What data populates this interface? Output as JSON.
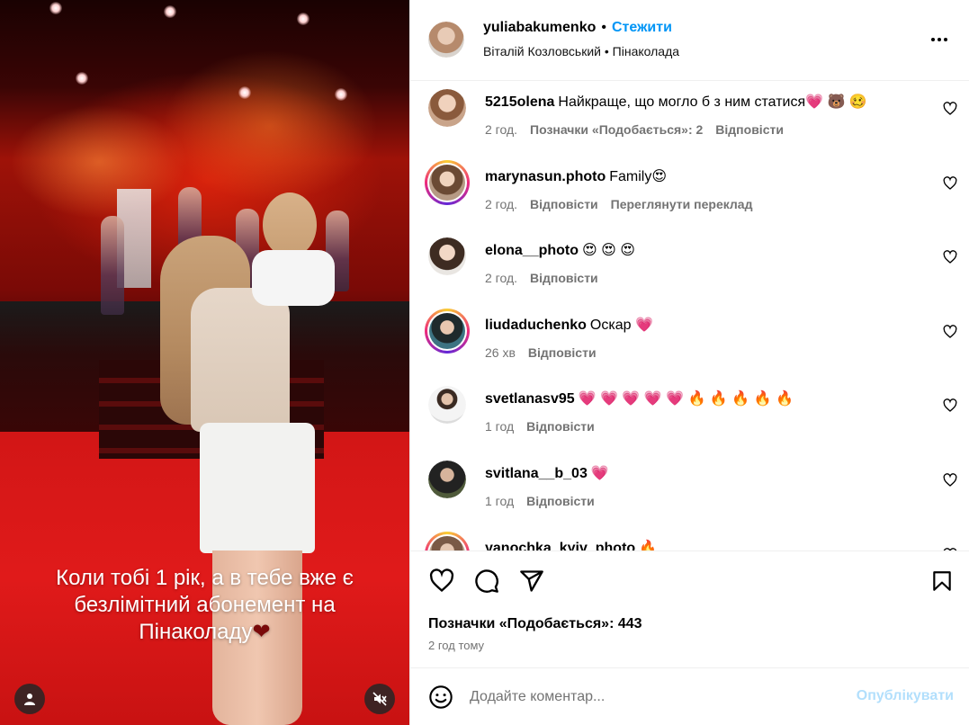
{
  "media": {
    "caption_lines": [
      "Коли тобі 1 рік, а в тебе вже є",
      "безлімітний абонемент на",
      "Пінаколаду"
    ],
    "caption_emoji": "❤",
    "caption_emoji_color": "#7a0a0a"
  },
  "header": {
    "username": "yuliabakumenko",
    "dot": "•",
    "follow_label": "Стежити",
    "subtitle_a": "Віталій Козловський",
    "subtitle_dot": "•",
    "subtitle_b": "Пінаколада"
  },
  "comments": [
    {
      "user": "5215olena",
      "text": "Найкраще, що могло б з ним статися💗 🐻 🥴",
      "time": "2 год.",
      "likes": "Позначки «Подобається»: 2",
      "reply": "Відповісти",
      "extra": "",
      "ring": false,
      "avatar_color": "#c9a48a"
    },
    {
      "user": "marynasun.photo",
      "text": "Family😍",
      "time": "2 год.",
      "likes": "",
      "reply": "Відповісти",
      "extra": "Переглянути переклад",
      "ring": true,
      "avatar_color": "#a7856b"
    },
    {
      "user": "elona__photo",
      "text": "😍 😍 😍",
      "time": "2 год.",
      "likes": "",
      "reply": "Відповісти",
      "extra": "",
      "ring": false,
      "avatar_color": "#6f5a4a"
    },
    {
      "user": "liudaduchenko",
      "text": "Оскар 💗",
      "time": "26 хв",
      "likes": "",
      "reply": "Відповісти",
      "extra": "",
      "ring": true,
      "avatar_color": "#2f5a66"
    },
    {
      "user": "svetlanasv95",
      "text": "💗 💗 💗 💗 💗 🔥 🔥 🔥 🔥 🔥",
      "time": "1 год",
      "likes": "",
      "reply": "Відповісти",
      "extra": "",
      "ring": false,
      "avatar_color": "#d8d8d8"
    },
    {
      "user": "svitlana__b_03",
      "text": "💗",
      "time": "1 год",
      "likes": "",
      "reply": "Відповісти",
      "extra": "",
      "ring": false,
      "avatar_color": "#3a3a3a"
    },
    {
      "user": "yanochka_kyiv_photo",
      "text": "🔥",
      "time": "",
      "likes": "",
      "reply": "",
      "extra": "",
      "ring": true,
      "avatar_color": "#9a7a66"
    }
  ],
  "actions": {
    "like_icon": "heart-icon",
    "comment_icon": "comment-icon",
    "share_icon": "send-icon",
    "save_icon": "bookmark-icon",
    "likes_text": "Позначки «Подобається»: 443",
    "posted_time": "2 год тому"
  },
  "add_comment": {
    "placeholder": "Додайте коментар...",
    "publish_label": "Опублікувати"
  },
  "colors": {
    "accent": "#0095f6",
    "publish_disabled": "#b2dffc",
    "muted": "#737373"
  }
}
